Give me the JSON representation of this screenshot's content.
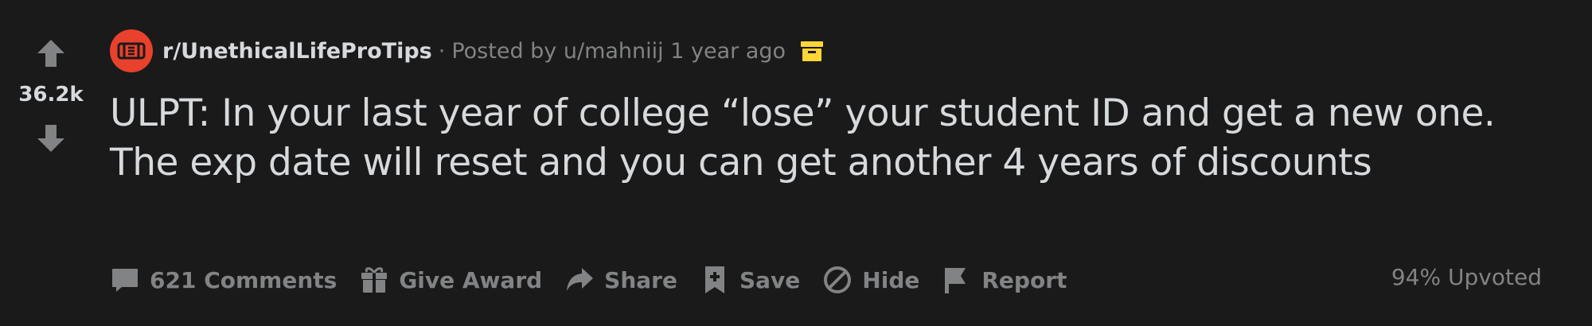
{
  "vote": {
    "score": "36.2k"
  },
  "meta": {
    "subreddit": "r/UnethicalLifeProTips",
    "separator": "·",
    "posted_by": "Posted by u/mahniij 1 year ago"
  },
  "post": {
    "title": "ULPT: In your last year of college “lose” your student ID and get a new one. The exp date will reset and you can get another 4 years of discounts"
  },
  "actions": {
    "comments": "621 Comments",
    "award": "Give Award",
    "share": "Share",
    "save": "Save",
    "hide": "Hide",
    "report": "Report"
  },
  "stats": {
    "upvoted": "94% Upvoted"
  },
  "colors": {
    "background": "#1a1a1b",
    "text": "#d7dadc",
    "muted": "#818384",
    "subreddit_icon": "#e8412c",
    "archive_icon": "#ffd635"
  }
}
